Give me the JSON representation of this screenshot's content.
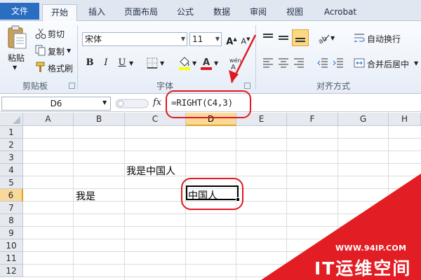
{
  "ribbon": {
    "tabs": [
      {
        "label": "文件"
      },
      {
        "label": "开始"
      },
      {
        "label": "插入"
      },
      {
        "label": "页面布局"
      },
      {
        "label": "公式"
      },
      {
        "label": "数据"
      },
      {
        "label": "审阅"
      },
      {
        "label": "视图"
      },
      {
        "label": "Acrobat"
      }
    ],
    "clipboard": {
      "paste": "粘贴",
      "cut": "剪切",
      "copy": "复制",
      "format_painter": "格式刷",
      "group_label": "剪贴板"
    },
    "font": {
      "font_name": "宋体",
      "font_size": "11",
      "bold": "B",
      "italic": "I",
      "underline": "U",
      "group_label": "字体"
    },
    "alignment": {
      "wrap_text": "自动换行",
      "merge_center": "合并后居中",
      "group_label": "对齐方式"
    }
  },
  "formula_bar": {
    "name_box": "D6",
    "fx": "fx",
    "formula": "=RIGHT(C4,3)"
  },
  "sheet": {
    "columns": [
      "A",
      "B",
      "C",
      "D",
      "E",
      "F",
      "G",
      "H"
    ],
    "selected_column": "D",
    "rows": [
      "1",
      "2",
      "3",
      "4",
      "5",
      "6",
      "7",
      "8",
      "9",
      "10",
      "11",
      "12"
    ],
    "selected_row": "6",
    "cells": {
      "C4": "我是中国人",
      "B6": "我是",
      "D6": "中国人"
    }
  },
  "watermark": {
    "url": "WWW.94IP.COM",
    "brand": "IT运维空间"
  },
  "colors": {
    "annotation": "#e0191e",
    "file_tab": "#2a6ec2",
    "selected_header": "#f9d99a",
    "watermark": "#e21d24"
  }
}
